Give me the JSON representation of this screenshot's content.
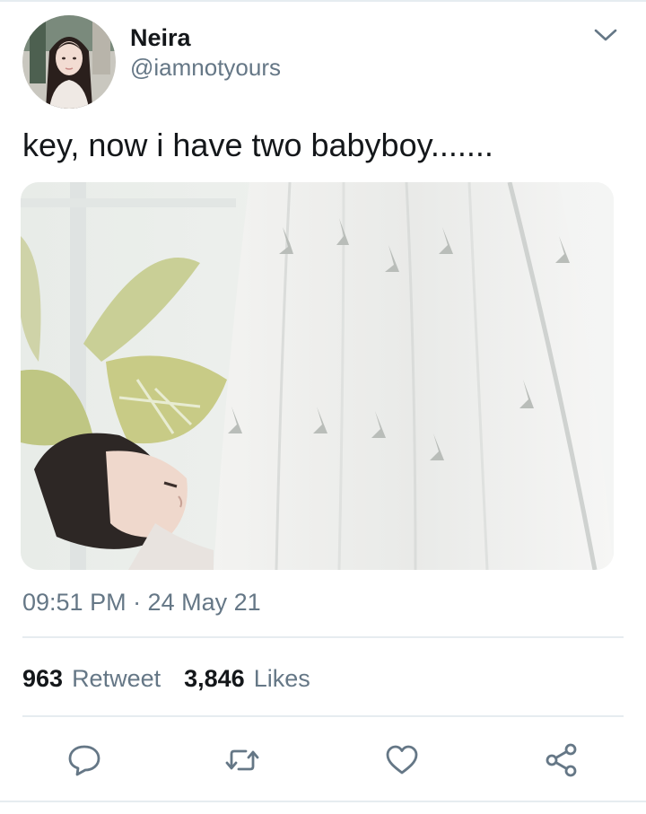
{
  "user": {
    "display_name": "Neira",
    "handle": "@iamnotyours"
  },
  "tweet": {
    "text": "key, now i have two babyboy.......",
    "timestamp": "09:51 PM · 24 May 21"
  },
  "stats": {
    "retweets_count": "963",
    "retweets_label": "Retweet",
    "likes_count": "3,846",
    "likes_label": "Likes"
  },
  "actions": [
    {
      "icon": "reply-icon"
    },
    {
      "icon": "retweet-icon"
    },
    {
      "icon": "like-icon"
    },
    {
      "icon": "share-icon"
    }
  ],
  "colors": {
    "text_primary": "#14171a",
    "text_secondary": "#657786",
    "divider": "#e6ecf0",
    "icon": "#657786"
  }
}
